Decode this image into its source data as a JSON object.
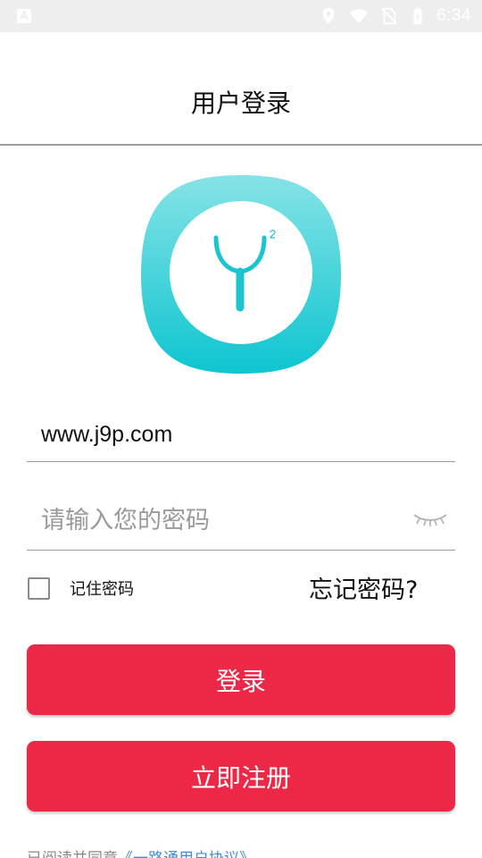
{
  "status_bar": {
    "time": "6:34",
    "icons": [
      "app-notification-icon",
      "location-icon",
      "wifi-icon",
      "no-sim-icon",
      "battery-charging-icon"
    ],
    "color_bg": "#eeeeee"
  },
  "header": {
    "title": "用户登录"
  },
  "logo": {
    "icon": "app-logo-icon",
    "colors": {
      "gradient_top": "#86e3e6",
      "gradient_bottom": "#0dc5d0"
    }
  },
  "form": {
    "username_value": "www.j9p.com",
    "password_placeholder": "请输入您的密码",
    "password_toggle_icon": "eye-closed-icon",
    "remember_label": "记住密码",
    "remember_checked": false,
    "forgot_label": "忘记密码?"
  },
  "buttons": {
    "login_label": "登录",
    "register_label": "立即注册",
    "color": "#ec2846"
  },
  "footer": {
    "text": "已阅读并同意",
    "link": "《一路通用户协议》"
  }
}
